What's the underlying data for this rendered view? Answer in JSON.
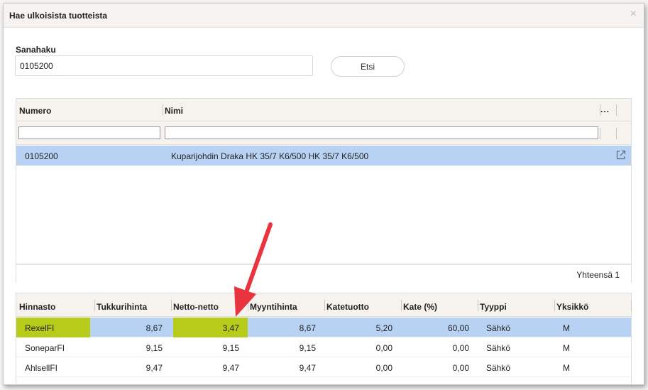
{
  "dialog": {
    "title": "Hae ulkoisista tuotteista",
    "close_label": "×"
  },
  "search": {
    "label": "Sanahaku",
    "value": "0105200",
    "button_label": "Etsi"
  },
  "products": {
    "columns": [
      "Numero",
      "Nimi"
    ],
    "more_label": "...",
    "rows": [
      {
        "numero": "0105200",
        "nimi": "Kuparijohdin Draka HK 35/7 K6/500 HK 35/7 K6/500"
      }
    ],
    "total_label": "Yhteensä 1"
  },
  "prices": {
    "columns": [
      "Hinnasto",
      "Tukkurihinta",
      "Netto-netto",
      "Myyntihinta",
      "Katetuotto",
      "Kate (%)",
      "Tyyppi",
      "Yksikkö"
    ],
    "rows": [
      {
        "hinnasto": "RexelFI",
        "tukkurihinta": "8,67",
        "netto": "3,47",
        "myyntihinta": "8,67",
        "katetuotto": "5,20",
        "kate": "60,00",
        "tyyppi": "Sähkö",
        "yksikko": "M"
      },
      {
        "hinnasto": "SoneparFI",
        "tukkurihinta": "9,15",
        "netto": "9,15",
        "myyntihinta": "9,15",
        "katetuotto": "0,00",
        "kate": "0,00",
        "tyyppi": "Sähkö",
        "yksikko": "M"
      },
      {
        "hinnasto": "AhlsellFI",
        "tukkurihinta": "9,47",
        "netto": "9,47",
        "myyntihinta": "9,47",
        "katetuotto": "0,00",
        "kate": "0,00",
        "tyyppi": "Sähkö",
        "yksikko": "M"
      }
    ]
  },
  "colors": {
    "selected_row": "#b8d2f4",
    "highlight": "#b7cb1a",
    "arrow": "#e8343f"
  }
}
